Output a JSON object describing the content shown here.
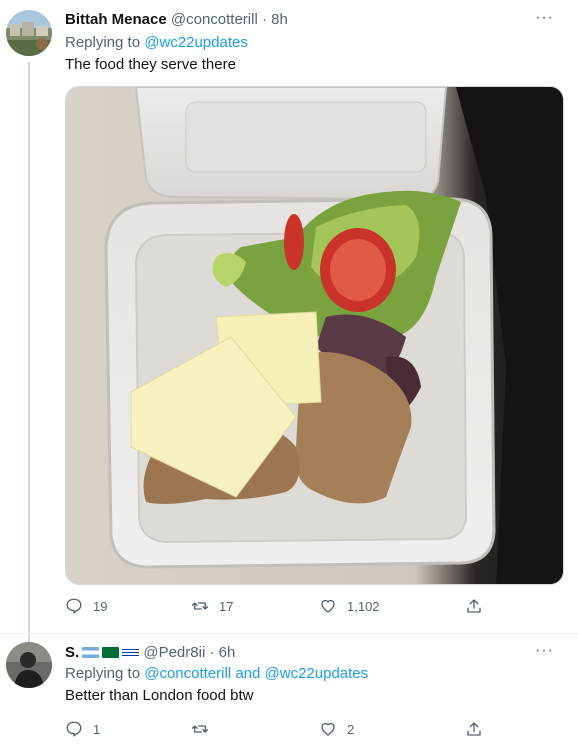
{
  "tweet1": {
    "author_name": "Bittah Menace",
    "handle": "@concotterill",
    "separator": "·",
    "time": "8h",
    "replying_label": "Replying to",
    "replying_to": "@wc22updates",
    "text": "The food they serve there",
    "media_icon": "photo-of-sandwich-in-foam-container",
    "stats": {
      "replies": "19",
      "retweets": "17",
      "likes": "1,102"
    }
  },
  "tweet2": {
    "author_name": "S.",
    "handle": "@Pedr8ii",
    "separator": "·",
    "time": "6h",
    "replying_label": "Replying to",
    "replying_to_1": "@concotterill",
    "replying_and": "and",
    "replying_to_2": "@wc22updates",
    "text": "Better than London food btw",
    "stats": {
      "replies": "1",
      "retweets": "",
      "likes": "2"
    }
  },
  "more_label": "···",
  "colors": {
    "link": "#1d9bf0",
    "muted": "#536471",
    "text": "#0f1419",
    "divider": "#eff3f4"
  }
}
